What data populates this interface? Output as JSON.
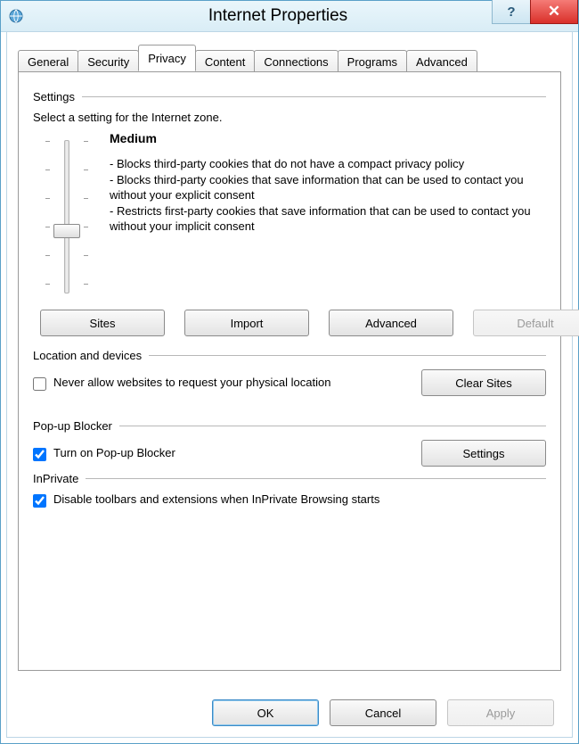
{
  "window": {
    "title": "Internet Properties"
  },
  "tabs": {
    "items": [
      "General",
      "Security",
      "Privacy",
      "Content",
      "Connections",
      "Programs",
      "Advanced"
    ],
    "active_index": 2
  },
  "settings": {
    "group_label": "Settings",
    "instruction": "Select a setting for the Internet zone.",
    "level_name": "Medium",
    "bullets": [
      "- Blocks third-party cookies that do not have a compact privacy policy",
      "- Blocks third-party cookies that save information that can be used to contact you without your explicit consent",
      "- Restricts first-party cookies that save information that can be used to contact you without your implicit consent"
    ],
    "slider": {
      "steps": 6,
      "value_index": 3
    },
    "buttons": {
      "sites": "Sites",
      "import": "Import",
      "advanced": "Advanced",
      "default": "Default"
    }
  },
  "location": {
    "group_label": "Location and devices",
    "checkbox_label": "Never allow websites to request your physical location",
    "checked": false,
    "clear_sites_label": "Clear Sites"
  },
  "popup": {
    "group_label": "Pop-up Blocker",
    "checkbox_label": "Turn on Pop-up Blocker",
    "checked": true,
    "settings_label": "Settings"
  },
  "inprivate": {
    "group_label": "InPrivate",
    "checkbox_label": "Disable toolbars and extensions when InPrivate Browsing starts",
    "checked": true
  },
  "dialog_buttons": {
    "ok": "OK",
    "cancel": "Cancel",
    "apply": "Apply"
  }
}
